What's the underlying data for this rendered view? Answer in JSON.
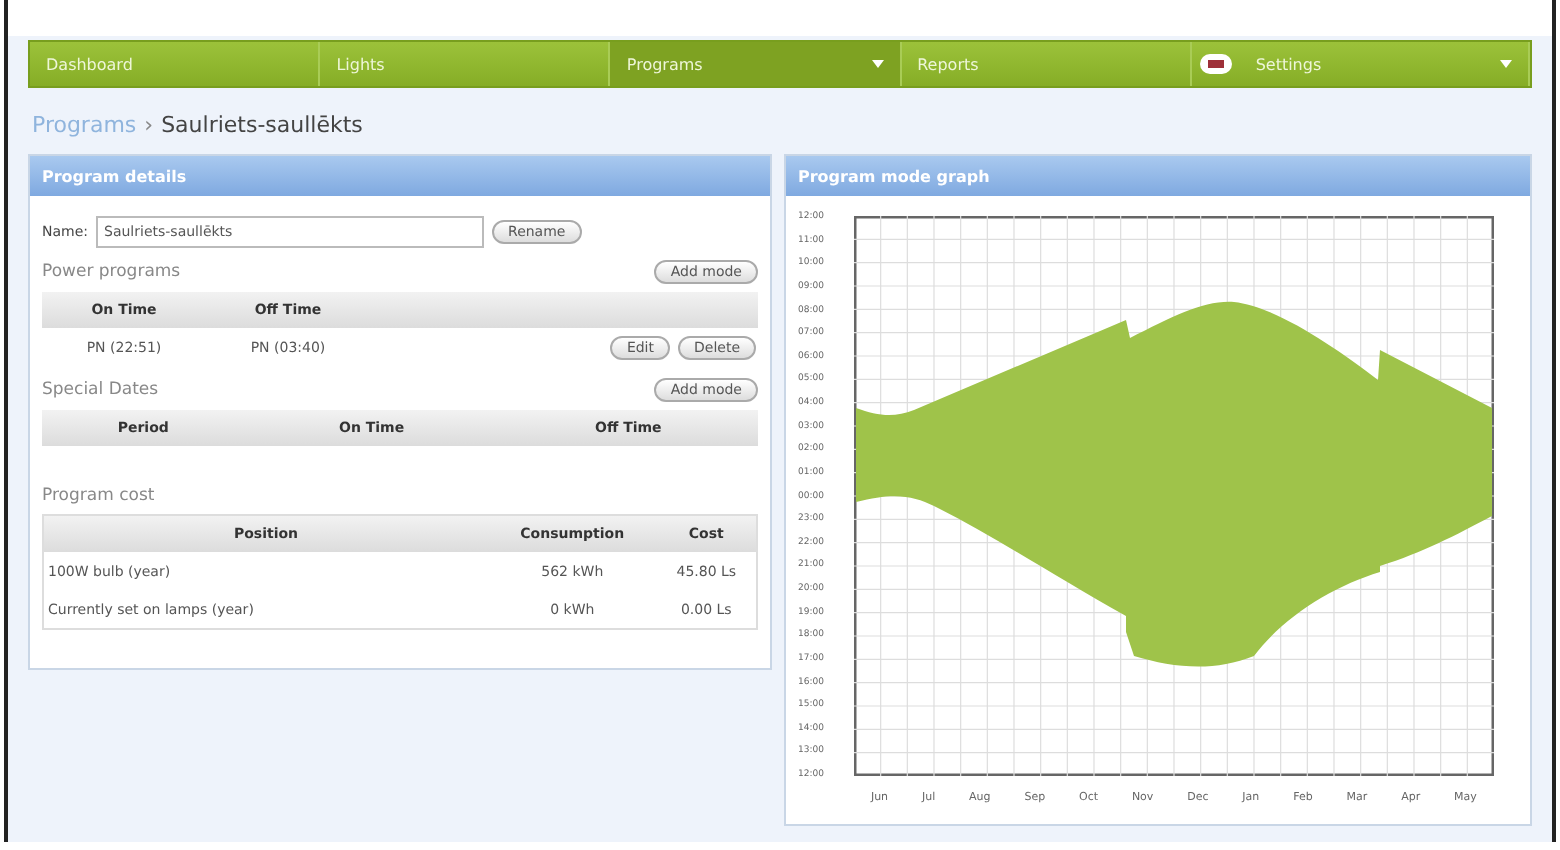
{
  "nav": [
    {
      "label": "Dashboard",
      "dropdown": false,
      "selected": false
    },
    {
      "label": "Lights",
      "dropdown": false,
      "selected": false
    },
    {
      "label": "Programs",
      "dropdown": true,
      "selected": true
    },
    {
      "label": "Reports",
      "dropdown": false,
      "selected": false
    },
    {
      "label": "Settings",
      "dropdown": true,
      "selected": false
    }
  ],
  "breadcrumb": {
    "parent": "Programs",
    "separator": "›",
    "current": "Saulriets-saullēkts"
  },
  "details": {
    "title": "Program details",
    "name_label": "Name:",
    "name_value": "Saulriets-saullēkts",
    "rename": "Rename",
    "power": {
      "title": "Power programs",
      "add": "Add mode",
      "columns": [
        "On Time",
        "Off Time"
      ],
      "rows": [
        {
          "on": "PN (22:51)",
          "off": "PN (03:40)",
          "actions": [
            "Edit",
            "Delete"
          ]
        }
      ]
    },
    "special": {
      "title": "Special Dates",
      "add": "Add mode",
      "columns": [
        "Period",
        "On Time",
        "Off Time"
      ]
    },
    "cost": {
      "title": "Program cost",
      "columns": [
        "Position",
        "Consumption",
        "Cost"
      ],
      "rows": [
        [
          "100W bulb (year)",
          "562 kWh",
          "45.80 Ls"
        ],
        [
          "Currently set on lamps (year)",
          "0 kWh",
          "0.00 Ls"
        ]
      ]
    }
  },
  "graph": {
    "title": "Program mode graph",
    "y_labels": [
      "12:00",
      "11:00",
      "10:00",
      "09:00",
      "08:00",
      "07:00",
      "06:00",
      "05:00",
      "04:00",
      "03:00",
      "02:00",
      "01:00",
      "00:00",
      "23:00",
      "22:00",
      "21:00",
      "20:00",
      "19:00",
      "18:00",
      "17:00",
      "16:00",
      "15:00",
      "14:00",
      "13:00",
      "12:00"
    ],
    "x_labels": [
      "Jun",
      "Jul",
      "Aug",
      "Sep",
      "Oct",
      "Nov",
      "Dec",
      "Jan",
      "Feb",
      "Mar",
      "Apr",
      "May"
    ]
  }
}
